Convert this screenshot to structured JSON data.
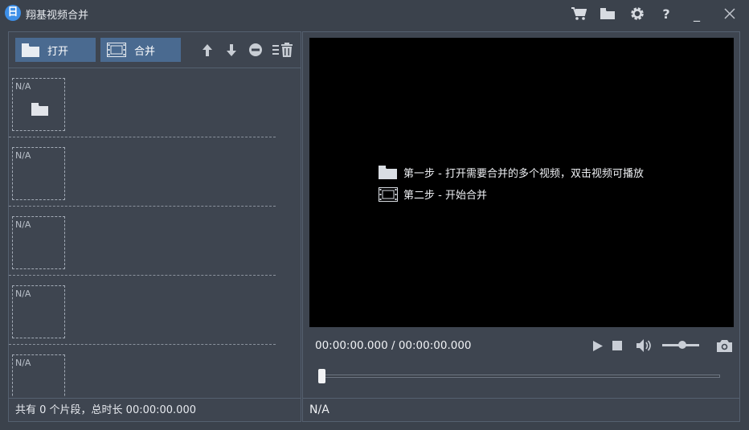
{
  "window": {
    "icon_glyph": "日",
    "title": "翔基视频合并",
    "controls": [
      "cart-icon",
      "folder-icon",
      "gear-icon",
      "help-icon",
      "minimize-icon",
      "close-icon"
    ],
    "help_glyph": "?",
    "minimize_glyph": "_"
  },
  "toolbar": {
    "open_label": "打开",
    "merge_label": "合并",
    "icons": [
      "arrow-up-icon",
      "arrow-down-icon",
      "remove-icon",
      "clear-list-icon"
    ]
  },
  "clips": [
    {
      "label": "N/A",
      "has_folder": true
    },
    {
      "label": "N/A",
      "has_folder": false
    },
    {
      "label": "N/A",
      "has_folder": false
    },
    {
      "label": "N/A",
      "has_folder": false
    },
    {
      "label": "N/A",
      "has_folder": false
    }
  ],
  "left_status": "共有 0 个片段，总时长 00:00:00.000",
  "preview": {
    "hint1": "第一步 - 打开需要合并的多个视频，双击视频可播放",
    "hint2": "第二步 - 开始合并",
    "hint_icons": [
      "folder-icon",
      "film-icon"
    ]
  },
  "player": {
    "time": "00:00:00.000 / 00:00:00.000",
    "controls": [
      "play-icon",
      "stop-icon",
      "volume-icon",
      "camera-icon"
    ],
    "volume_fraction": 0.5,
    "seek_fraction": 0.0
  },
  "right_status": "N/A",
  "colors": {
    "accent_button": "#4a6a90",
    "background": "#3b424c",
    "app_icon": "#3d8fe8"
  }
}
